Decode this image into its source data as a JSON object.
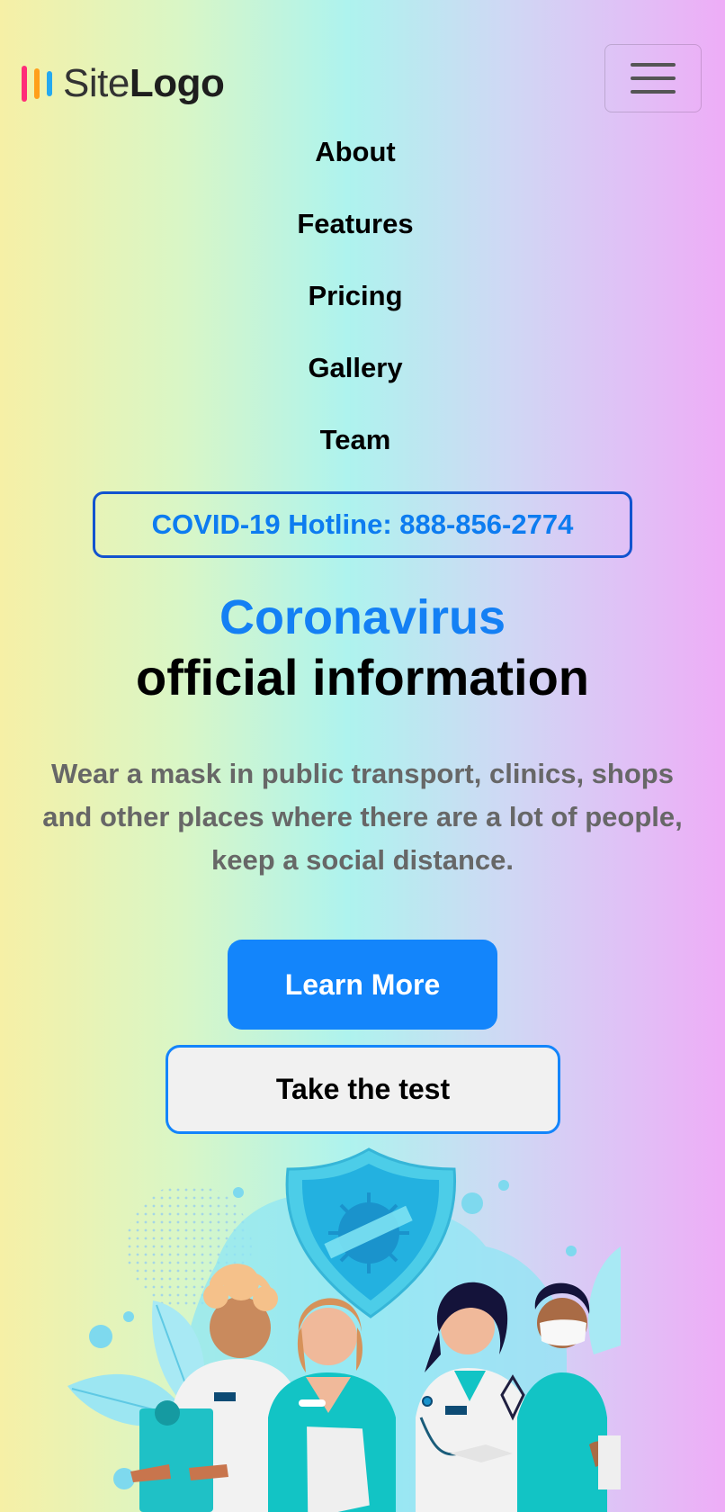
{
  "header": {
    "logo": {
      "text_light": "Site",
      "text_bold": "Logo",
      "bar_colors": [
        "#ff2d78",
        "#ff9f1a",
        "#25a9f0"
      ]
    },
    "menu_icon": "hamburger-menu-icon"
  },
  "nav": {
    "items": [
      {
        "label": "About"
      },
      {
        "label": "Features"
      },
      {
        "label": "Pricing"
      },
      {
        "label": "Gallery"
      },
      {
        "label": "Team"
      }
    ]
  },
  "hotline": {
    "label": "COVID-19 Hotline: 888-856-2774",
    "color": "#0d7cf0"
  },
  "hero": {
    "title_accent": "Coronavirus",
    "title_main": "official information",
    "description": "Wear a mask in public transport, clinics, shops and other places where there are a lot of people, keep a social distance.",
    "accent_color": "#1480f4"
  },
  "actions": {
    "primary_label": "Learn More",
    "secondary_label": "Take the test",
    "primary_color": "#1385fb"
  },
  "illustration": {
    "icon": "medical-team-illustration",
    "shield_icon": "virus-shield-icon"
  }
}
